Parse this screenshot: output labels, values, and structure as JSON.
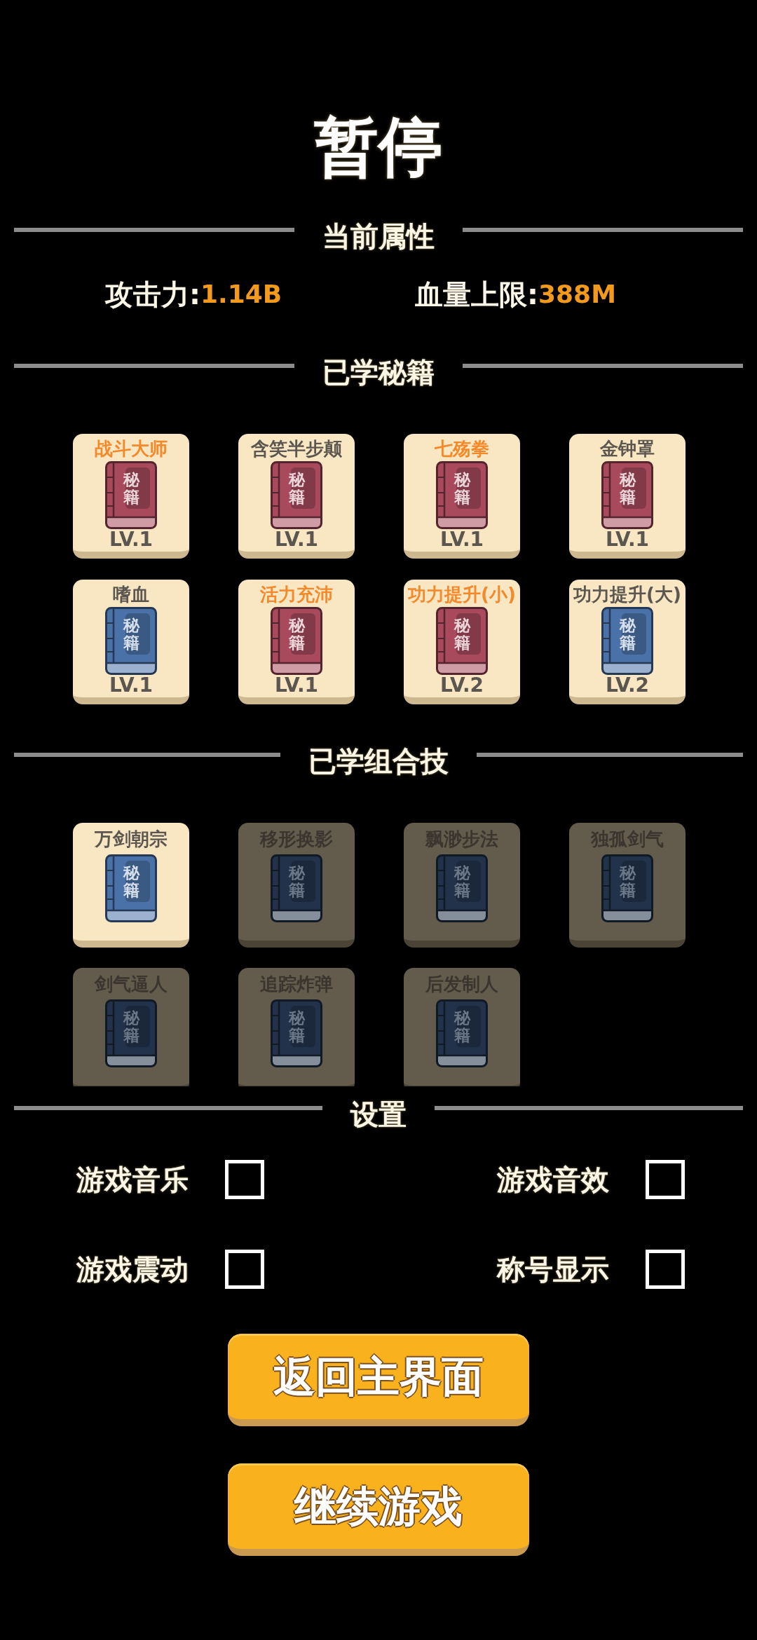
{
  "title": "暂停",
  "attributes_section": {
    "heading": "当前属性",
    "stats": [
      {
        "label": "攻击力:",
        "value": "1.14B"
      },
      {
        "label": "血量上限:",
        "value": "388M"
      }
    ]
  },
  "skills_section": {
    "heading": "已学秘籍",
    "skills": [
      {
        "name": "战斗大师",
        "highlighted": true,
        "color": "#a84a5c",
        "book_label": "秘籍",
        "lv": "LV.1"
      },
      {
        "name": "含笑半步颠",
        "highlighted": false,
        "color": "#a84a5c",
        "book_label": "秘籍",
        "lv": "LV.1"
      },
      {
        "name": "七殇拳",
        "highlighted": true,
        "color": "#a84a5c",
        "book_label": "秘籍",
        "lv": "LV.1"
      },
      {
        "name": "金钟罩",
        "highlighted": false,
        "color": "#a84a5c",
        "book_label": "秘籍",
        "lv": "LV.1"
      },
      {
        "name": "嗜血",
        "highlighted": false,
        "color": "#4a72a8",
        "book_label": "秘籍",
        "lv": "LV.1"
      },
      {
        "name": "活力充沛",
        "highlighted": true,
        "color": "#a84a5c",
        "book_label": "秘籍",
        "lv": "LV.1"
      },
      {
        "name": "功力提升(小)",
        "highlighted": true,
        "color": "#a84a5c",
        "book_label": "秘籍",
        "lv": "LV.2"
      },
      {
        "name": "功力提升(大)",
        "highlighted": false,
        "color": "#4a72a8",
        "book_label": "秘籍",
        "lv": "LV.2"
      }
    ]
  },
  "combos_section": {
    "heading": "已学组合技",
    "combos": [
      {
        "name": "万剑朝宗",
        "unlocked": true,
        "book_label": "秘籍"
      },
      {
        "name": "移形换影",
        "unlocked": false,
        "book_label": "秘籍"
      },
      {
        "name": "飘渺步法",
        "unlocked": false,
        "book_label": "秘籍"
      },
      {
        "name": "独孤剑气",
        "unlocked": false,
        "book_label": "秘籍"
      },
      {
        "name": "剑气逼人",
        "unlocked": false,
        "book_label": "秘籍"
      },
      {
        "name": "追踪炸弹",
        "unlocked": false,
        "book_label": "秘籍"
      },
      {
        "name": "后发制人",
        "unlocked": false,
        "book_label": "秘籍"
      }
    ]
  },
  "settings_section": {
    "heading": "设置",
    "options": [
      {
        "label": "游戏音乐",
        "checked": false
      },
      {
        "label": "游戏音效",
        "checked": false
      },
      {
        "label": "游戏震动",
        "checked": false
      },
      {
        "label": "称号显示",
        "checked": false
      }
    ]
  },
  "buttons": [
    {
      "label": "返回主界面"
    },
    {
      "label": "继续游戏"
    }
  ]
}
